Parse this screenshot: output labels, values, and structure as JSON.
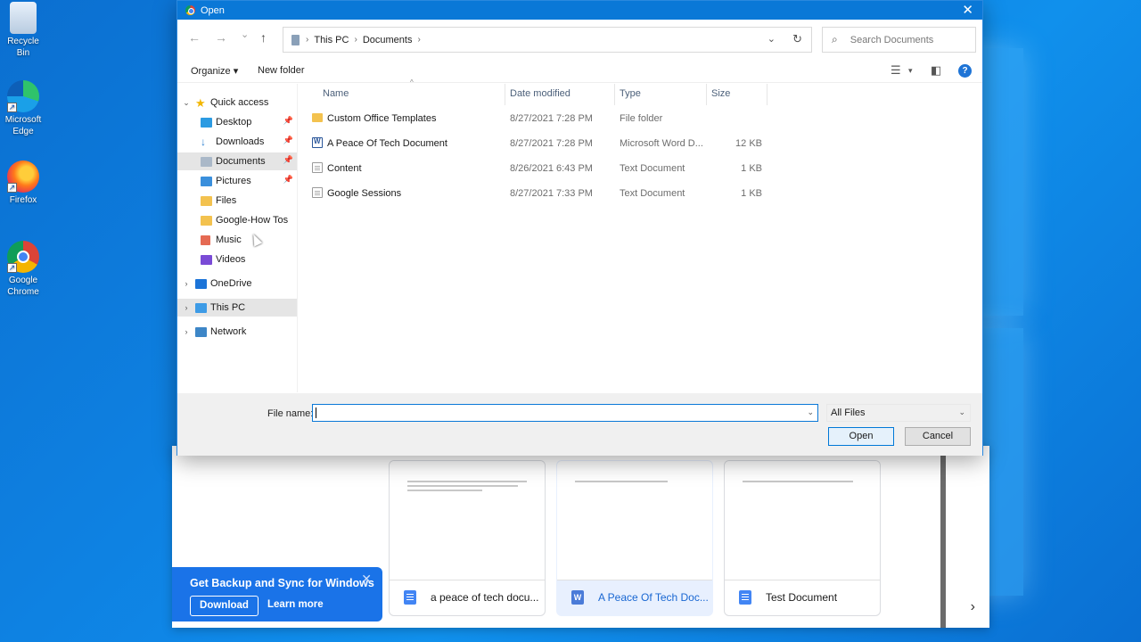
{
  "desktop": {
    "icons": [
      {
        "label": "Recycle Bin"
      },
      {
        "label": "Microsoft Edge"
      },
      {
        "label": "Firefox"
      },
      {
        "label": "Google Chrome"
      }
    ]
  },
  "drive": {
    "cards": [
      {
        "name": "a peace of tech docu...",
        "icon": "google-doc-icon",
        "preview": "A peace of tech document for testing purposes. The sentence is detecting google how to use google drive and other google services."
      },
      {
        "name": "A Peace Of Tech Doc...",
        "icon": "word-doc-icon",
        "preview": "Test document for the Peace Of Tech document files",
        "selected": true
      },
      {
        "name": "Test Document",
        "icon": "google-doc-icon",
        "preview": "Test document for showing before how to create a document in google docs."
      }
    ],
    "promo": {
      "title": "Get Backup and Sync for Windows",
      "download": "Download",
      "learn_more": "Learn more"
    },
    "next_glyph": "›"
  },
  "dialog": {
    "title": "Open",
    "close_glyph": "✕",
    "nav": {
      "back": "←",
      "forward": "→",
      "recent": "⌄",
      "up": "↑"
    },
    "breadcrumb": [
      "This PC",
      "Documents"
    ],
    "search_placeholder": "Search Documents",
    "toolbar": {
      "organize": "Organize ▾",
      "new_folder": "New folder"
    },
    "sidebar": [
      {
        "label": "Quick access",
        "icon": "star-icon",
        "level": 0,
        "chevron": "⌄"
      },
      {
        "label": "Desktop",
        "icon": "desktop-icon",
        "level": 1,
        "pinned": true
      },
      {
        "label": "Downloads",
        "icon": "download-icon",
        "level": 1,
        "pinned": true
      },
      {
        "label": "Documents",
        "icon": "documents-icon",
        "level": 1,
        "pinned": true,
        "selected": true
      },
      {
        "label": "Pictures",
        "icon": "pictures-icon",
        "level": 1,
        "pinned": true
      },
      {
        "label": "Files",
        "icon": "folder-icon",
        "level": 1
      },
      {
        "label": "Google-How Tos",
        "icon": "folder-icon",
        "level": 1
      },
      {
        "label": "Music",
        "icon": "music-icon",
        "level": 1
      },
      {
        "label": "Videos",
        "icon": "videos-icon",
        "level": 1
      },
      {
        "label": "OneDrive",
        "icon": "cloud-icon",
        "level": 0,
        "chevron": "›"
      },
      {
        "label": "This PC",
        "icon": "pc-icon",
        "level": 0,
        "chevron": "›",
        "highlight": true
      },
      {
        "label": "Network",
        "icon": "network-icon",
        "level": 0,
        "chevron": "›"
      }
    ],
    "columns": [
      "Name",
      "Date modified",
      "Type",
      "Size"
    ],
    "files": [
      {
        "name": "Custom Office Templates",
        "date": "8/27/2021 7:28 PM",
        "type": "File folder",
        "size": "",
        "icon": "folder"
      },
      {
        "name": "A Peace Of Tech Document",
        "date": "8/27/2021 7:28 PM",
        "type": "Microsoft Word D...",
        "size": "12 KB",
        "icon": "worddoc"
      },
      {
        "name": "Content",
        "date": "8/26/2021 6:43 PM",
        "type": "Text Document",
        "size": "1 KB",
        "icon": "txt"
      },
      {
        "name": "Google Sessions",
        "date": "8/27/2021 7:33 PM",
        "type": "Text Document",
        "size": "1 KB",
        "icon": "txt"
      }
    ],
    "filename_label": "File name:",
    "filename_value": "",
    "file_filter": "All Files",
    "open_label": "Open",
    "cancel_label": "Cancel"
  }
}
